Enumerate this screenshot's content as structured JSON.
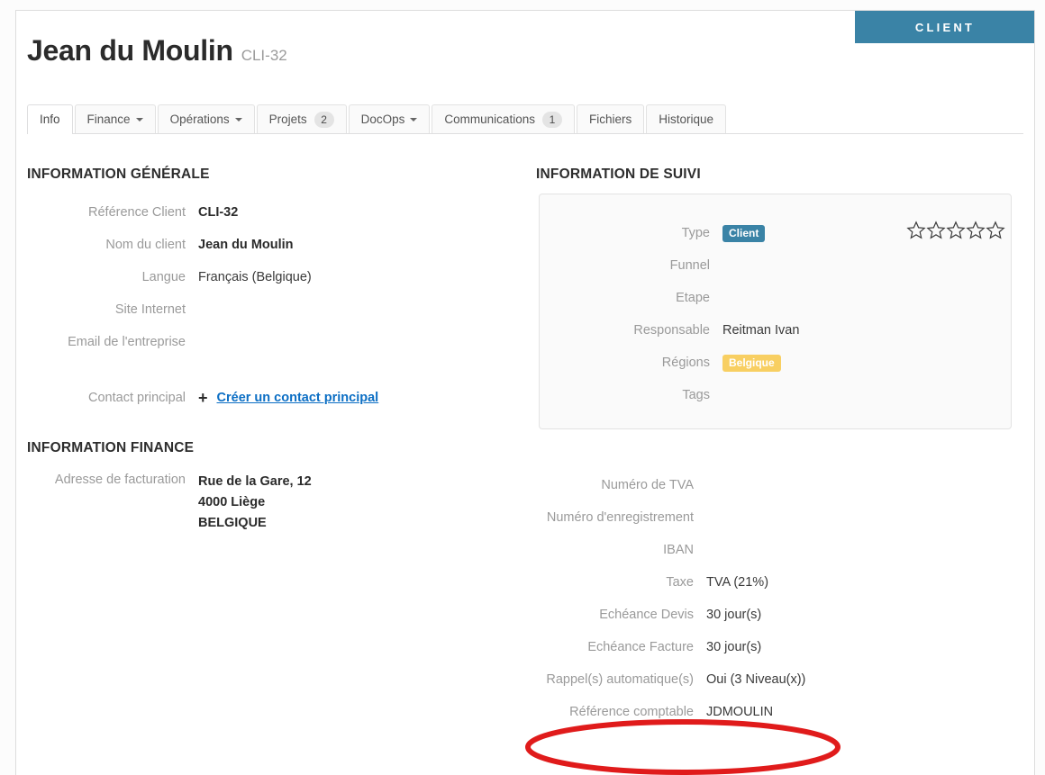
{
  "banner": {
    "label": "CLIENT",
    "color": "#3a83a6"
  },
  "header": {
    "title": "Jean du Moulin",
    "reference": "CLI-32"
  },
  "tabs": [
    {
      "label": "Info",
      "active": true,
      "caret": false,
      "badge": null
    },
    {
      "label": "Finance",
      "active": false,
      "caret": true,
      "badge": null
    },
    {
      "label": "Opérations",
      "active": false,
      "caret": true,
      "badge": null
    },
    {
      "label": "Projets",
      "active": false,
      "caret": false,
      "badge": "2"
    },
    {
      "label": "DocOps",
      "active": false,
      "caret": true,
      "badge": null
    },
    {
      "label": "Communications",
      "active": false,
      "caret": false,
      "badge": "1"
    },
    {
      "label": "Fichiers",
      "active": false,
      "caret": false,
      "badge": null
    },
    {
      "label": "Historique",
      "active": false,
      "caret": false,
      "badge": null
    }
  ],
  "sections": {
    "generale": "INFORMATION GÉNÉRALE",
    "suivi": "INFORMATION DE SUIVI",
    "finance": "INFORMATION FINANCE"
  },
  "generale": {
    "reference_client": {
      "label": "Référence Client",
      "value": "CLI-32"
    },
    "nom_du_client": {
      "label": "Nom du client",
      "value": "Jean du Moulin"
    },
    "langue": {
      "label": "Langue",
      "value": "Français (Belgique)"
    },
    "site_internet": {
      "label": "Site Internet",
      "value": ""
    },
    "email_entreprise": {
      "label": "Email de l'entreprise",
      "value": ""
    },
    "contact_principal": {
      "label": "Contact principal",
      "plus_icon": "+",
      "link": "Créer un contact principal"
    }
  },
  "suivi": {
    "type": {
      "label": "Type",
      "value": "Client",
      "badge_color": "#3a83a6"
    },
    "funnel": {
      "label": "Funnel",
      "value": ""
    },
    "etape": {
      "label": "Etape",
      "value": ""
    },
    "responsable": {
      "label": "Responsable",
      "value": "Reitman Ivan"
    },
    "regions": {
      "label": "Régions",
      "value": "Belgique",
      "badge_color": "#f8cf62"
    },
    "tags": {
      "label": "Tags",
      "value": ""
    },
    "rating": {
      "max": 5,
      "filled": 0
    }
  },
  "finance_left": {
    "adresse_facturation": {
      "label": "Adresse de facturation",
      "value": "Rue de la Gare, 12\n4000 Liège\nBELGIQUE"
    }
  },
  "finance_right": [
    {
      "label": "Numéro de TVA",
      "value": ""
    },
    {
      "label": "Numéro d'enregistrement",
      "value": ""
    },
    {
      "label": "IBAN",
      "value": ""
    },
    {
      "label": "Taxe",
      "value": "TVA (21%)"
    },
    {
      "label": "Echéance Devis",
      "value": "30 jour(s)"
    },
    {
      "label": "Echéance Facture",
      "value": "30 jour(s)"
    },
    {
      "label": "Rappel(s) automatique(s)",
      "value": "Oui (3 Niveau(x))"
    },
    {
      "label": "Référence comptable",
      "value": "JDMOULIN"
    }
  ],
  "annotation": {
    "shape": "ellipse",
    "color": "#e01b1b",
    "target": "Référence comptable"
  }
}
